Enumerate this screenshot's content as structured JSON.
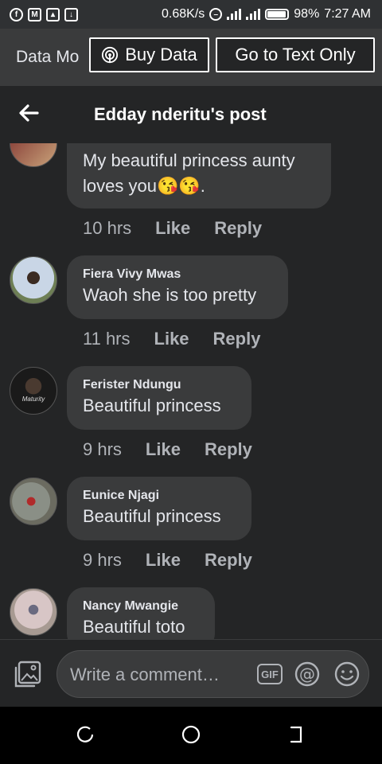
{
  "status_bar": {
    "speed": "0.68K/s",
    "battery": "98%",
    "time": "7:27 AM",
    "left_icons": [
      "facebook-icon",
      "gmail-icon",
      "image-icon",
      "download-icon"
    ],
    "right_icons": [
      "dnd-icon",
      "signal-4g-icon",
      "signal-icon",
      "battery-icon"
    ]
  },
  "data_bar": {
    "mode_label": "Data Mo",
    "buy_label": "Buy Data",
    "text_only_label": "Go to Text Only"
  },
  "header": {
    "title": "Edday nderitu's post",
    "back_icon": "back-arrow-icon"
  },
  "comments": [
    {
      "author": "",
      "text": "My beautiful princess aunty loves you",
      "emoji": "😘😘.",
      "time": "10 hrs",
      "like": "Like",
      "reply": "Reply"
    },
    {
      "author": "Fiera Vivy Mwas",
      "text": "Waoh she is too pretty",
      "time": "11 hrs",
      "like": "Like",
      "reply": "Reply"
    },
    {
      "author": "Ferister Ndungu",
      "text": "Beautiful princess",
      "time": "9 hrs",
      "like": "Like",
      "reply": "Reply",
      "avatar_caption": "Maturity"
    },
    {
      "author": "Eunice Njagi",
      "text": "Beautiful princess",
      "time": "9 hrs",
      "like": "Like",
      "reply": "Reply"
    },
    {
      "author": "Nancy Mwangie",
      "text": "Beautiful toto"
    }
  ],
  "composer": {
    "placeholder": "Write a comment…",
    "gif_label": "GIF",
    "icons": [
      "photo-icon",
      "gif-icon",
      "at-mention-icon",
      "emoji-icon"
    ]
  },
  "colors": {
    "status_bar_bg": "#2f3133",
    "data_bar_bg": "#3a3b3c",
    "page_bg": "#242526",
    "bubble_bg": "#3a3b3c",
    "text_primary": "#e4e6eb",
    "text_secondary": "#b0b3b8"
  }
}
